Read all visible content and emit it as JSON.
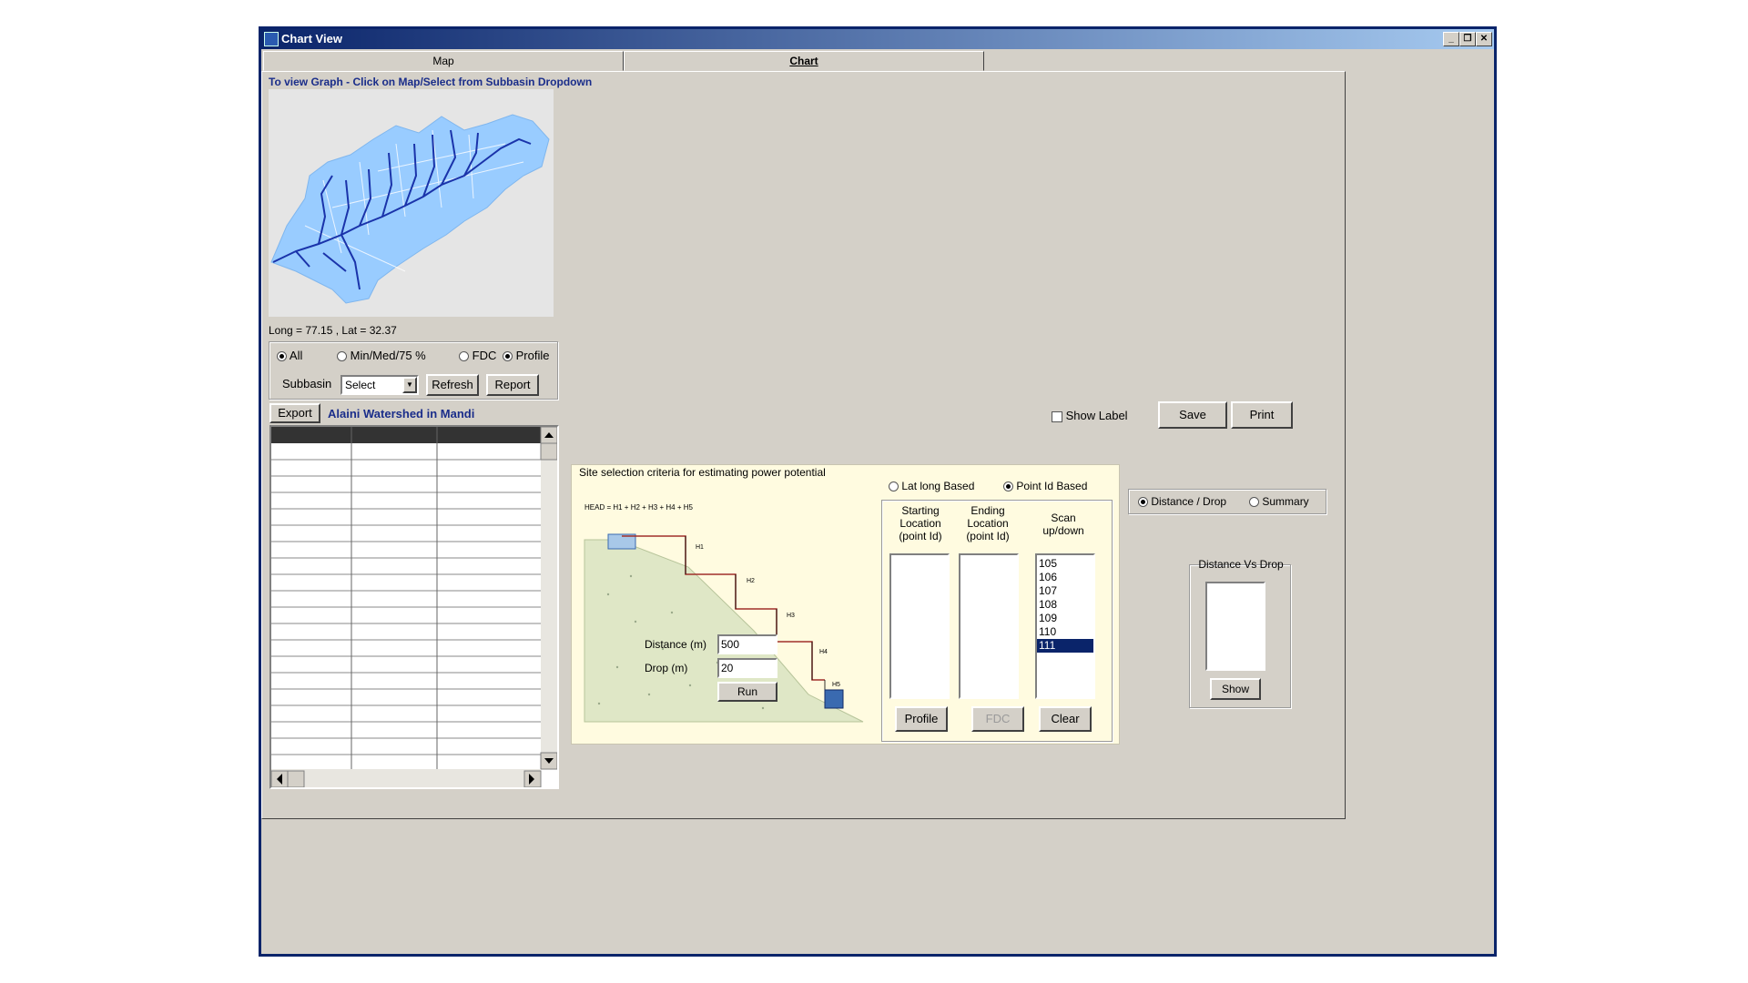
{
  "window": {
    "title": "Chart View",
    "min_icon": "minimize-icon",
    "max_icon": "restore-icon",
    "close_icon": "close-icon"
  },
  "tabs": [
    {
      "label": "Map"
    },
    {
      "label": "Chart"
    }
  ],
  "instruction": "To view Graph - Click on Map/Select from Subbasin Dropdown",
  "coordinates": "Long = 77.15 , Lat = 32.37",
  "filters": {
    "all": "All",
    "minmed": "Min/Med/75 %",
    "fdc": "FDC",
    "profile": "Profile"
  },
  "subbasin": {
    "label": "Subbasin",
    "value": "Select",
    "refresh": "Refresh",
    "report": "Report"
  },
  "export_label": "Export",
  "watershed_title": "Alaini Watershed in Mandi",
  "chart_controls": {
    "show_label": "Show Label",
    "save": "Save",
    "print": "Print"
  },
  "site": {
    "legend": "Site selection criteria for estimating power potential",
    "latlong": "Lat long Based",
    "pointid": "Point Id Based",
    "formula": "HEAD = H1 + H2 + H3 + H4 + H5",
    "distance_label": "Distance (m)",
    "distance_value": "500",
    "drop_label": "Drop (m)",
    "drop_value": "20",
    "run": "Run",
    "col_start": "Starting Location (point Id)",
    "col_end": "Ending Location (point Id)",
    "col_scan": "Scan up/down",
    "scan_items": [
      "105",
      "106",
      "107",
      "108",
      "109",
      "110",
      "111"
    ],
    "scan_selected": "111",
    "profile_btn": "Profile",
    "fdc_btn": "FDC",
    "clear_btn": "Clear",
    "step_labels": [
      "H1",
      "H2",
      "H3",
      "H4",
      "H5"
    ]
  },
  "view_mode": {
    "dist": "Distance / Drop",
    "summary": "Summary"
  },
  "distance_vs_drop": {
    "title": "Distance Vs Drop",
    "show": "Show"
  },
  "colors": {
    "title_bar": "#0a246a",
    "watershed": "#99ccff",
    "streams": "#1a33aa",
    "site_panel": "#fffbe0",
    "selection": "#0a246a"
  }
}
